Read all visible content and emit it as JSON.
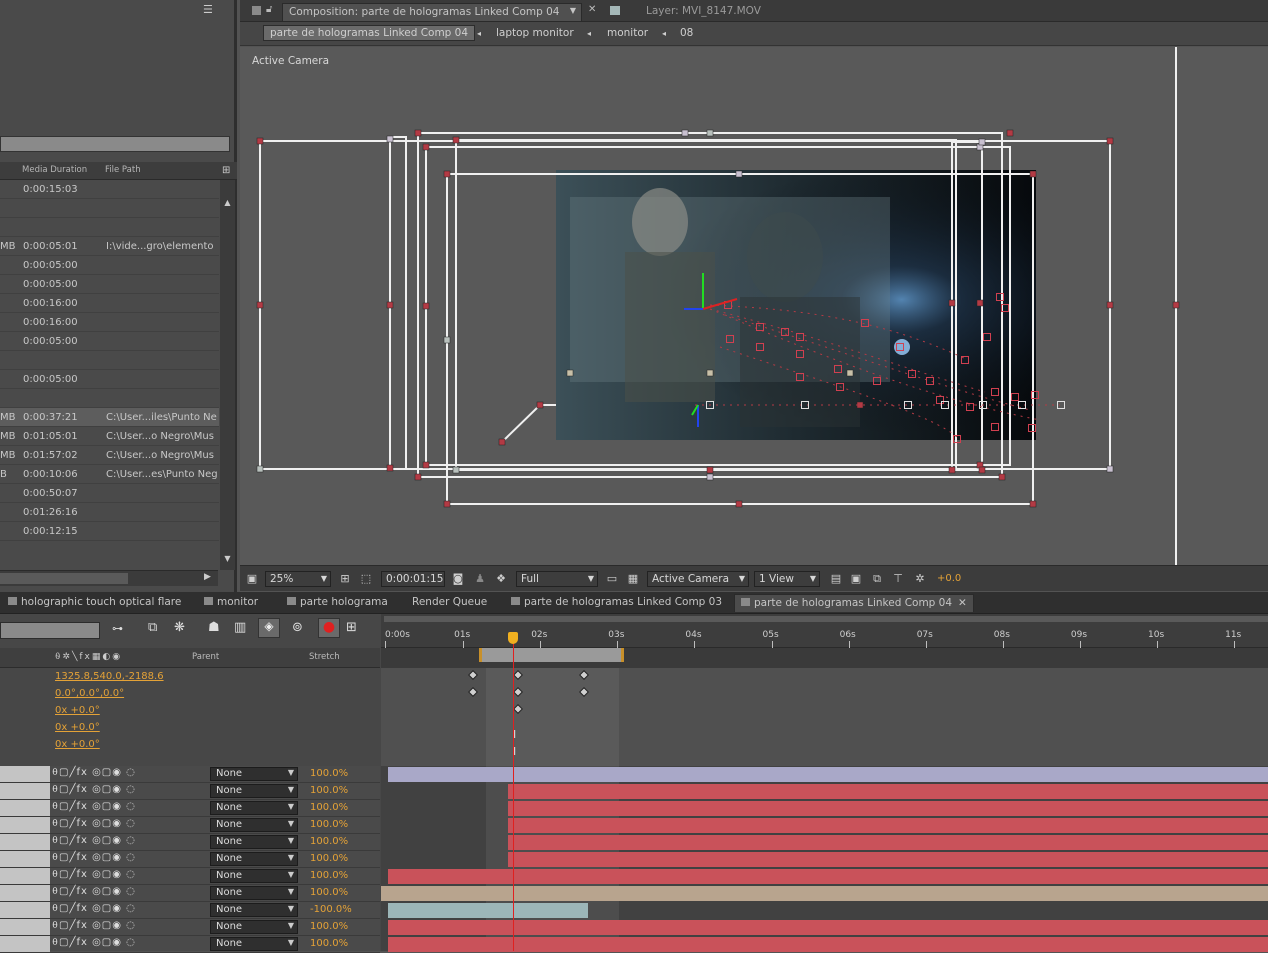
{
  "project": {
    "columns": [
      "Media Duration",
      "File Path"
    ],
    "rows": [
      {
        "size": "",
        "duration": "0:00:15:03",
        "path": ""
      },
      {
        "size": "",
        "duration": "",
        "path": ""
      },
      {
        "size": "",
        "duration": "",
        "path": ""
      },
      {
        "size": "MB",
        "duration": "0:00:05:01",
        "path": "I:\\vide...gro\\elemento"
      },
      {
        "size": "",
        "duration": "0:00:05:00",
        "path": ""
      },
      {
        "size": "",
        "duration": "0:00:05:00",
        "path": ""
      },
      {
        "size": "",
        "duration": "0:00:16:00",
        "path": ""
      },
      {
        "size": "",
        "duration": "0:00:16:00",
        "path": ""
      },
      {
        "size": "",
        "duration": "0:00:05:00",
        "path": ""
      },
      {
        "size": "",
        "duration": "",
        "path": ""
      },
      {
        "size": "",
        "duration": "0:00:05:00",
        "path": ""
      },
      {
        "size": "",
        "duration": "",
        "path": ""
      },
      {
        "size": "MB",
        "duration": "0:00:37:21",
        "path": "C:\\User...iles\\Punto Ne"
      },
      {
        "size": "MB",
        "duration": "0:01:05:01",
        "path": "C:\\User...o Negro\\Mus"
      },
      {
        "size": "MB",
        "duration": "0:01:57:02",
        "path": "C:\\User...o Negro\\Mus"
      },
      {
        "size": "B",
        "duration": "0:00:10:06",
        "path": "C:\\User...es\\Punto Neg"
      },
      {
        "size": "",
        "duration": "0:00:50:07",
        "path": ""
      },
      {
        "size": "",
        "duration": "0:01:26:16",
        "path": ""
      },
      {
        "size": "",
        "duration": "0:00:12:15",
        "path": ""
      }
    ]
  },
  "comp": {
    "tab_comp": "Composition: parte de hologramas Linked Comp 04",
    "tab_layer": "Layer: MVI_8147.MOV",
    "breadcrumbs": [
      "parte de hologramas Linked Comp 04",
      "laptop monitor",
      "monitor",
      "08"
    ],
    "camera_label": "Active Camera",
    "footer": {
      "zoom": "25%",
      "timecode": "0:00:01:15",
      "resolution": "Full",
      "camera": "Active Camera",
      "views": "1 View",
      "exposure": "+0.0"
    }
  },
  "timeline": {
    "tabs": [
      "holographic touch optical flare",
      "monitor",
      "parte holograma",
      "Render Queue",
      "parte de hologramas Linked Comp 03",
      "parte de hologramas Linked Comp 04"
    ],
    "ruler": [
      "0:00s",
      "01s",
      "02s",
      "03s",
      "04s",
      "05s",
      "06s",
      "07s",
      "08s",
      "09s",
      "10s",
      "11s"
    ],
    "col_parent": "Parent",
    "col_stretch": "Stretch",
    "props": [
      "1325.8,540.0,-2188.6",
      "0.0°,0.0°,0.0°",
      "0x +0.0°",
      "0x +0.0°",
      "0x +0.0°"
    ],
    "layers": [
      {
        "parent": "None",
        "stretch": "100.0%"
      },
      {
        "parent": "None",
        "stretch": "100.0%"
      },
      {
        "parent": "None",
        "stretch": "100.0%"
      },
      {
        "parent": "None",
        "stretch": "100.0%"
      },
      {
        "parent": "None",
        "stretch": "100.0%"
      },
      {
        "parent": "None",
        "stretch": "100.0%"
      },
      {
        "parent": "None",
        "stretch": "100.0%"
      },
      {
        "parent": "None",
        "stretch": "100.0%"
      },
      {
        "parent": "None",
        "stretch": "-100.0%"
      },
      {
        "parent": "None",
        "stretch": "100.0%"
      },
      {
        "parent": "None",
        "stretch": "100.0%"
      }
    ],
    "colors": {
      "layer_red": "#c9525a",
      "layer_lavender": "#a9a8c8",
      "layer_tan": "#b8a48e",
      "layer_teal": "#9cb6b8",
      "playhead": "#e02020",
      "prop_orange": "#e4a237"
    }
  }
}
